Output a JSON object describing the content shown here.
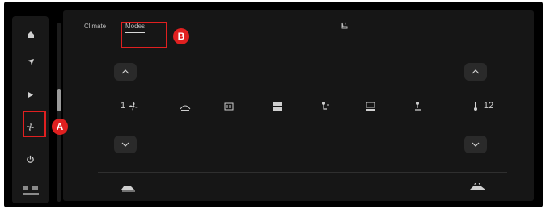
{
  "tabs": {
    "climate_label": "Climate",
    "modes_label": "Modes",
    "extra_tab_icon": "seat-heat-icon"
  },
  "sidebar": {
    "items": [
      {
        "name": "home",
        "icon": "home-icon"
      },
      {
        "name": "navigation",
        "icon": "navigation-arrow-icon"
      },
      {
        "name": "media",
        "icon": "play-icon"
      },
      {
        "name": "climate",
        "icon": "fan-icon"
      },
      {
        "name": "power",
        "icon": "power-icon"
      }
    ],
    "logo_lines": [
      "",
      ""
    ]
  },
  "controls": {
    "left_value": "1",
    "right_value": "12",
    "mode_items": [
      {
        "name": "max-defrost",
        "icon": "defrost-max-icon"
      },
      {
        "name": "rear-defrost",
        "icon": "rear-defrost-icon"
      },
      {
        "name": "air-floor",
        "icon": "air-floor-icon"
      },
      {
        "name": "air-face",
        "icon": "air-face-icon"
      },
      {
        "name": "air-face-floor",
        "icon": "air-face-floor-icon"
      },
      {
        "name": "recirculation",
        "icon": "recirculation-icon"
      },
      {
        "name": "air-defrost-floor",
        "icon": "air-defrost-floor-icon"
      }
    ]
  },
  "callouts": {
    "a": "A",
    "b": "B"
  },
  "colors": {
    "callout_red": "#e02020",
    "panel_bg": "#161616",
    "frame_bg": "#000000"
  }
}
